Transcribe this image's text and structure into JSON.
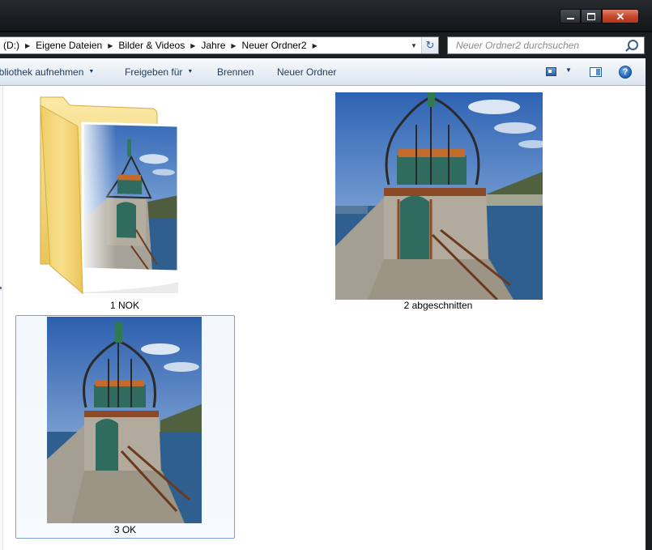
{
  "window": {
    "buttons": {
      "close_glyph": "✕"
    }
  },
  "address": {
    "crumbs": [
      "(D:)",
      "Eigene Dateien",
      "Bilder & Videos",
      "Jahre",
      "Neuer Ordner2"
    ],
    "refresh_glyph": "↻"
  },
  "search": {
    "placeholder": "Neuer Ordner2 durchsuchen"
  },
  "toolbar": {
    "library_label": "ibliothek aufnehmen",
    "share_label": "Freigeben für",
    "burn_label": "Brennen",
    "new_folder_label": "Neuer Ordner",
    "help_glyph": "?"
  },
  "items": [
    {
      "name": "1 NOK",
      "kind": "folder"
    },
    {
      "name": "2 abgeschnitten",
      "kind": "image"
    },
    {
      "name": "3 OK",
      "kind": "image"
    }
  ],
  "colors": {
    "selection_border": "#7da2ce",
    "sky": "#3f73bf",
    "sea": "#2f5f8f",
    "stone": "#a7a299",
    "rust": "#8a4a26",
    "door": "#2f6b5e",
    "folder": "#f5d87a"
  },
  "icons": [
    "minimize-icon",
    "maximize-icon",
    "close-icon",
    "chevron-right-icon",
    "refresh-icon",
    "search-icon",
    "chevron-down-icon",
    "change-view-icon",
    "preview-pane-icon",
    "help-icon",
    "folder-icon"
  ]
}
